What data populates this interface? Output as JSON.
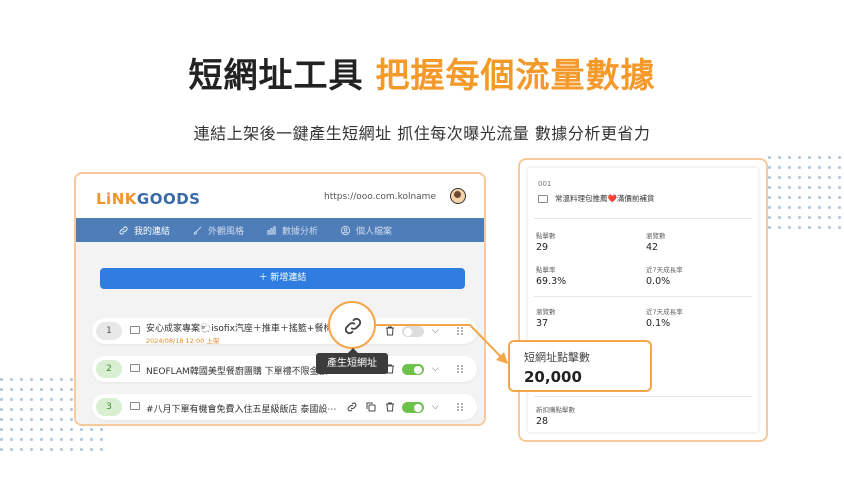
{
  "hero": {
    "title_dark": "短網址工具",
    "title_accent": "把握每個流量數據",
    "subtitle": "連結上架後一鍵產生短網址 抓住每次曝光流量 數據分析更省力"
  },
  "colors": {
    "accent": "#f39a2b",
    "nav": "#4e7db8",
    "primary": "#2f7de0",
    "toggle_on": "#6cc24a"
  },
  "app": {
    "logo_prefix": "LiNK",
    "logo_suffix": "GOODS",
    "url": "https://ooo.com.kolname",
    "nav": [
      {
        "label": "我的連結",
        "icon": "link-icon"
      },
      {
        "label": "外觀風格",
        "icon": "brush-icon"
      },
      {
        "label": "數據分析",
        "icon": "chart-icon"
      },
      {
        "label": "個人檔案",
        "icon": "user-icon"
      }
    ],
    "add_button": "＋ 新增連結",
    "links": [
      {
        "num": "1",
        "title": "安心成家專案🐑isofix汽座＋推車＋搖籃+餐椅＋",
        "date": "2024/08/18 12:00 上架",
        "enabled": false
      },
      {
        "num": "2",
        "title": "NEOFLAM韓國美型餐廚團購 下單禮不限金額",
        "date": "",
        "enabled": true
      },
      {
        "num": "3",
        "title": "#八月下單有機會免費入住五星級飯店 泰國設⋯",
        "date": "",
        "enabled": true
      }
    ],
    "tooltip": "產生短網址"
  },
  "stats": {
    "id": "001",
    "title": "常溫料理包推薦❤️滿價前補貨",
    "clicks_label": "點擊數",
    "clicks": "29",
    "views_label": "瀏覽數",
    "views": "42",
    "ctr_label": "點擊率",
    "ctr": "69.3%",
    "growth1_label": "近7天成長率",
    "growth1": "0.0%",
    "viewers_label": "瀏覽數",
    "viewers": "37",
    "growth2_label": "近7天成長率",
    "growth2": "0.1%",
    "new_clicks_label": "新扣購點擊數",
    "new_clicks": "28"
  },
  "callout": {
    "label": "短網址點擊數",
    "value": "20,000"
  }
}
